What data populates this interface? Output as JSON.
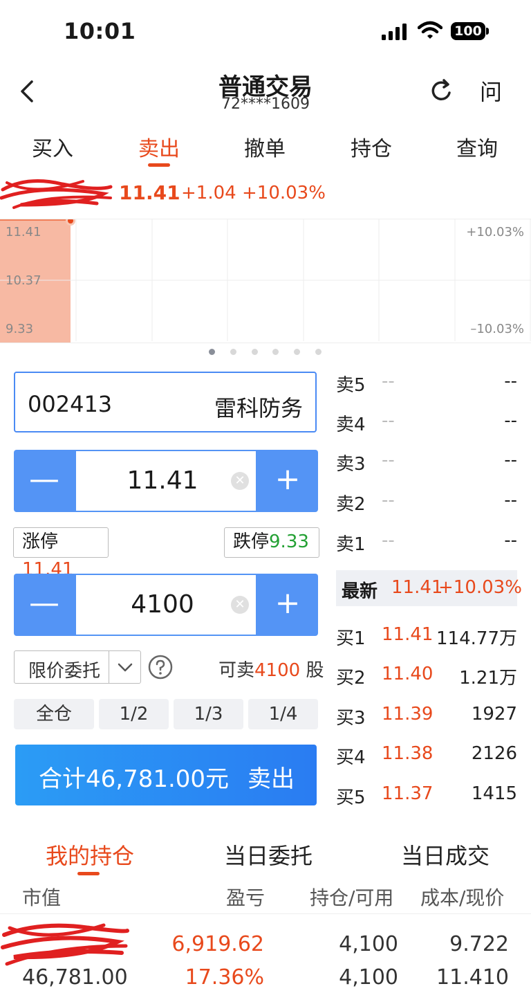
{
  "status": {
    "time": "10:01",
    "battery": "100"
  },
  "nav": {
    "title": "普通交易",
    "account": "72****1609",
    "help": "问"
  },
  "tabs": [
    "买入",
    "卖出",
    "撤单",
    "持仓",
    "查询"
  ],
  "quote": {
    "price": "11.41",
    "change": "+1.04",
    "change_pct": "+10.03%"
  },
  "chart_labels": {
    "top_price": "11.41",
    "mid_price": "10.37",
    "bottom_price": "9.33",
    "top_pct": "+10.03%",
    "bottom_pct": "–10.03%"
  },
  "order": {
    "code": "002413",
    "name": "雷科防务",
    "price": "11.41",
    "limit_up_label": "涨停",
    "limit_up": "11.41",
    "limit_down_label": "跌停",
    "limit_down": "9.33",
    "quantity": "4100",
    "order_type": "限价委托",
    "avail_label": "可卖",
    "avail_qty": "4100",
    "avail_unit": "股",
    "position_buttons": [
      "全仓",
      "1/2",
      "1/3",
      "1/4"
    ],
    "submit_total": "合计46,781.00元",
    "submit_action": "卖出"
  },
  "order_book": {
    "asks": [
      {
        "label": "卖5",
        "price": "--",
        "vol": "--"
      },
      {
        "label": "卖4",
        "price": "--",
        "vol": "--"
      },
      {
        "label": "卖3",
        "price": "--",
        "vol": "--"
      },
      {
        "label": "卖2",
        "price": "--",
        "vol": "--"
      },
      {
        "label": "卖1",
        "price": "--",
        "vol": "--"
      }
    ],
    "latest": {
      "label": "最新",
      "price": "11.41",
      "pct": "+10.03%"
    },
    "bids": [
      {
        "label": "买1",
        "price": "11.41",
        "vol": "114.77万"
      },
      {
        "label": "买2",
        "price": "11.40",
        "vol": "1.21万"
      },
      {
        "label": "买3",
        "price": "11.39",
        "vol": "1927"
      },
      {
        "label": "买4",
        "price": "11.38",
        "vol": "2126"
      },
      {
        "label": "买5",
        "price": "11.37",
        "vol": "1415"
      }
    ]
  },
  "bottom_tabs": [
    "我的持仓",
    "当日委托",
    "当日成交"
  ],
  "holdings": {
    "headers": [
      "市值",
      "盈亏",
      "持仓/可用",
      "成本/现价"
    ],
    "row": {
      "market_value": "46,781.00",
      "profit": "6,919.62",
      "profit_pct": "17.36%",
      "position": "4,100",
      "available": "4,100",
      "cost": "9.722",
      "current": "11.410"
    }
  },
  "colors": {
    "accent": "#e8491c",
    "blue": "#5494f5",
    "green": "#23a033"
  }
}
